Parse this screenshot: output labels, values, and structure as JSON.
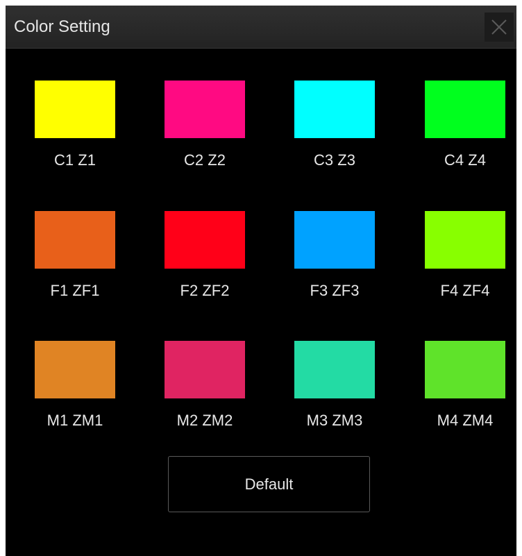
{
  "dialog": {
    "title": "Color Setting",
    "close_icon": "close-icon"
  },
  "swatches": [
    {
      "label": "C1 Z1",
      "color": "#ffff00"
    },
    {
      "label": "C2 Z2",
      "color": "#ff0a82"
    },
    {
      "label": "C3 Z3",
      "color": "#00ffff"
    },
    {
      "label": "C4 Z4",
      "color": "#00ff1e"
    },
    {
      "label": "F1 ZF1",
      "color": "#e8601a"
    },
    {
      "label": "F2 ZF2",
      "color": "#ff0018"
    },
    {
      "label": "F3 ZF3",
      "color": "#00a2ff"
    },
    {
      "label": "F4 ZF4",
      "color": "#88ff00"
    },
    {
      "label": "M1 ZM1",
      "color": "#e08424"
    },
    {
      "label": "M2 ZM2",
      "color": "#e02462"
    },
    {
      "label": "M3 ZM3",
      "color": "#23dba4"
    },
    {
      "label": "M4 ZM4",
      "color": "#5fe32a"
    }
  ],
  "default_button": {
    "label": "Default"
  }
}
